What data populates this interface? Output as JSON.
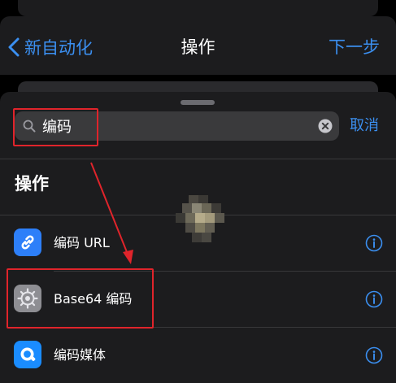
{
  "nav": {
    "back_label": "新自动化",
    "title": "操作",
    "next_label": "下一步"
  },
  "search": {
    "value": "编码",
    "cancel_label": "取消"
  },
  "section": {
    "title": "操作"
  },
  "actions": [
    {
      "label": "编码 URL",
      "icon": "link-icon",
      "icon_color": "#2d7ff9"
    },
    {
      "label": "Base64 编码",
      "icon": "gear-icon",
      "icon_color": "#8e8e93"
    },
    {
      "label": "编码媒体",
      "icon": "quicktime-icon",
      "icon_color": "#1a8cff"
    }
  ],
  "colors": {
    "accent": "#3b8ff0",
    "highlight": "#e0242b",
    "sheet": "#1c1c1e"
  }
}
